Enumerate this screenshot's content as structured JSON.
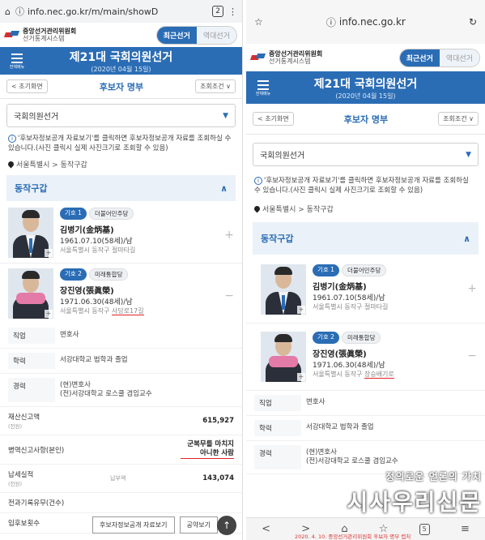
{
  "left": {
    "browser": {
      "url": "info.nec.go.kr/m/main/showD",
      "tab_count": "2",
      "menu": "⋮"
    },
    "site": {
      "org": "중앙선거관리위원회",
      "system": "선거통계시스템",
      "tab_recent": "최근선거",
      "tab_past": "역대선거"
    },
    "header": {
      "menu_label": "전체메뉴",
      "title": "제21대 국회의원선거",
      "date": "(2020년 04월 15일)"
    },
    "subnav": {
      "back": "< 초기화면",
      "title": "후보자 명부",
      "filter": "조회조건 ∨"
    },
    "select_value": "국회의원선거",
    "notice": "'후보자정보공개 자료보기'를 클릭하면 후보자정보공개 자료를 조회하실 수 있습니다.(사진 클릭시 실제 사진크기로 조회할 수 있음)",
    "crumb": "서울특별시 > 동작구갑",
    "district": "동작구갑",
    "candidates": [
      {
        "num": "기호 1",
        "party": "더불어민주당",
        "name": "김병기(金炳基)",
        "birth": "1961.07.10(58세)/남",
        "addr": "서울특별시 동작구 절마타길"
      },
      {
        "num": "기호 2",
        "party": "미래통합당",
        "name": "장진영(張眞榮)",
        "birth": "1971.06.30(48세)/남",
        "addr_prefix": "서울특별시 동작구 ",
        "addr_marked": "사당로17길"
      }
    ],
    "details": [
      {
        "k": "직업",
        "v": "변호사"
      },
      {
        "k": "학력",
        "v": "서강대학교 법학과 졸업"
      },
      {
        "k": "경력",
        "v": "(현)변호사\n(전)서강대학교 로스쿨 겸임교수"
      }
    ],
    "assets": {
      "label": "재산신고액",
      "unit": "(천원)",
      "value": "615,927"
    },
    "military": {
      "label": "병역신고사항(본인)",
      "value": "군복무를 마치지 아니한 사람"
    },
    "tax": {
      "label": "납세실적",
      "unit": "(천원)",
      "sub": "납부액",
      "value": "143,074"
    },
    "criminal": {
      "label": "전과기록유무(건수)"
    },
    "candidacy": {
      "label": "입후보횟수"
    },
    "buttons": {
      "info": "후보자정보공개 자료보기",
      "pledge": "공약보기"
    },
    "up": "↑"
  },
  "right": {
    "browser": {
      "url": "info.nec.go.kr"
    },
    "site": {
      "org": "중앙선거관리위원회",
      "system": "선거통계시스템",
      "tab_recent": "최근선거",
      "tab_past": "역대선거"
    },
    "header": {
      "menu_label": "전체메뉴",
      "title": "제21대 국회의원선거",
      "date": "(2020년 04월 15일)"
    },
    "subnav": {
      "back": "< 초기화면",
      "title": "후보자 명부",
      "filter": "조회조건 ∨"
    },
    "select_value": "국회의원선거",
    "notice": "'후보자정보공개 자료보기'를 클릭하면 후보자정보공개 자료를 조회하실 수 있습니다.(사진 클릭시 실제 사진크기로 조회할 수 있음)",
    "crumb": "서울특별시 > 동작구갑",
    "district": "동작구갑",
    "candidates": [
      {
        "num": "기호 1",
        "party": "더불어민주당",
        "name": "김병기(金炳基)",
        "birth": "1961.07.10(58세)/남",
        "addr": "서울특별시 동작구 절마타길"
      },
      {
        "num": "기호 2",
        "party": "미래통합당",
        "name": "장진영(張眞榮)",
        "birth": "1971.06.30(48세)/남",
        "addr_prefix": "서울특별시 동작구 ",
        "addr_marked": "장승배기로"
      }
    ],
    "details": [
      {
        "k": "직업",
        "v": "변호사"
      },
      {
        "k": "학력",
        "v": "서강대학교 법학과 졸업"
      },
      {
        "k": "경력",
        "v": "(현)변호사\n(전)서강대학교 로스쿨 겸임교수"
      }
    ],
    "watermark": {
      "slogan": "정의로운 언론의 가치",
      "brand": "시사우리신문"
    },
    "footnote": "2020. 4. 10. 중앙선거관리위원회 후보자 명부 캡처",
    "nav": {
      "back": "<",
      "forward": ">",
      "home": "⌂",
      "star": "☆",
      "tabs": "5",
      "menu": "≡"
    }
  }
}
